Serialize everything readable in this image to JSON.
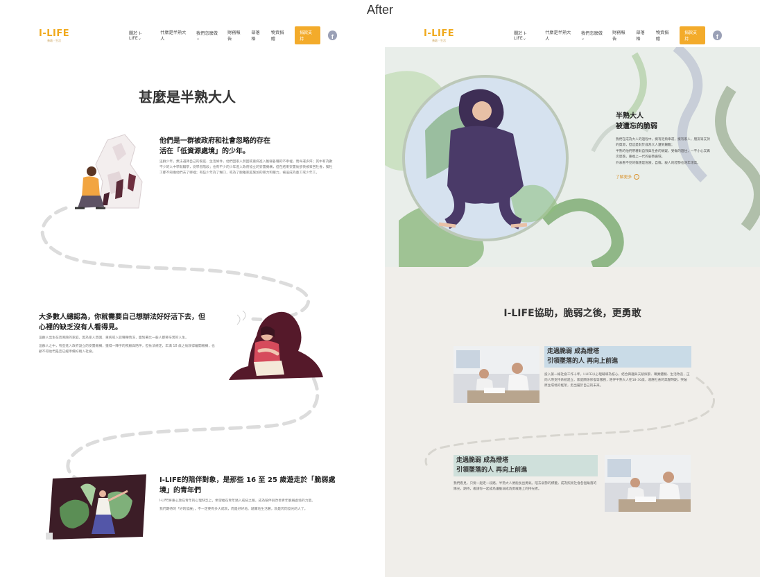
{
  "caption": "After",
  "nav": {
    "logo": "I-LIFE",
    "logo_tagline": "勇敢 · 生活",
    "items": [
      "關於 I-LIFE⌄",
      "什麼是半熟大人",
      "我們怎麼做⌄",
      "財務報告",
      "部落格",
      "物資捐贈"
    ],
    "donate": "捐款支持",
    "fb": "f"
  },
  "left": {
    "title": "甚麼是半熟大人",
    "sec1": {
      "h_line1": "他們是一群被政府和社會忽略的存在",
      "h_line2": "活在「低資源處境」的少年。",
      "p": "這群少年，無法選擇自己的家庭、生活條件，他們因家人貧困或重病進入脆弱各種的不幸裡，而命運多舛；其中有為數不少的人中學就輟學，從學習階段；也有不少的少年進入政府協立的安置機構，但在結束安置後卻快被丟回社會，獨社工都不知擔他們去了哪裡；有些少年為了糊口，或為了脫離家庭施加的暴力和壓力，被迫成為童工或少年工。"
    },
    "sec2": {
      "h_line1": "大多數人總認為，你就需要自己想辦法好好活下去，但",
      "h_line2": "心裡的缺乏沒有人看得見。",
      "p1": "這群人出生在高風險的家庭，因為家人貧困、重病或入獄種種情況，面對著比一般人都要辛苦的人生。",
      "p2": "這群人之中，有些進入政府設立的安置機構，獲得一陣子的照顧與陪伴，但依法規定，年滿 18 歲之後就得離開機構，也顧不得他們是否已經準備好踏入社會。"
    },
    "sec3": {
      "h_line1": "I-LIFE的陪伴對象，是那些 16 至 25 歲遊走於「脆弱處",
      "h_line2": "境」的青年們",
      "p1": "I-LIFE將重心放在青年的心理缺乏上，希望給在青年踏入成技之路，成為陪伴與改善青年脆弱處境的力量。",
      "p2": "我們期待的「好的發展」，不一定要有多大成就，而是好好地、踏實地生活著，就是閃閃發光的人了。"
    }
  },
  "right": {
    "hero": {
      "h_line1": "半熟大人",
      "h_line2": "被遺忘的脆弱",
      "p1": "我們在成為大人的過程中，擁有足夠幸運，擁有家人、朋友等支持的資源，但這是對於成為大人還到艱難；",
      "p2": "半熟的他們帶著對自我與社會的懷疑，受傷的過往，一不小心又再次墜落，重複上一代的弱勢循環。",
      "p3": "外表看不見的傷害是危險，自傷，殺人的證勢也逐年增高。",
      "more": "了解更多"
    },
    "heading": "I-LIFE協助，脆弱之後，更勇敢",
    "card1": {
      "t1": "走過脆弱 成為燈塔",
      "t2": "引領墜落的人 再向上前進",
      "p": "投入第一線社會工作十年，I-LIFE以心理輔導為核心，結合興趣與天賦探索、職業體驗、生活改造，正向人際支持系統建立、家庭關係修復等服務，陪伴半熟大人在18-30歲，適應社會的高壓時期，突破原生環境的框架，走出屬於自己的未來。"
    },
    "card2": {
      "t1": "走過脆弱 成為燈塔",
      "t2": "引領墜落的人 再向上前進",
      "p": "我們看見，只要一起走一段路，半熟大人便能長出勇氣。陪去弱勢的標籤，成為照亮社會各個角落的陽光，期待，邀請你一起成為讓脆弱成為勇敢路上的持光者。"
    }
  }
}
